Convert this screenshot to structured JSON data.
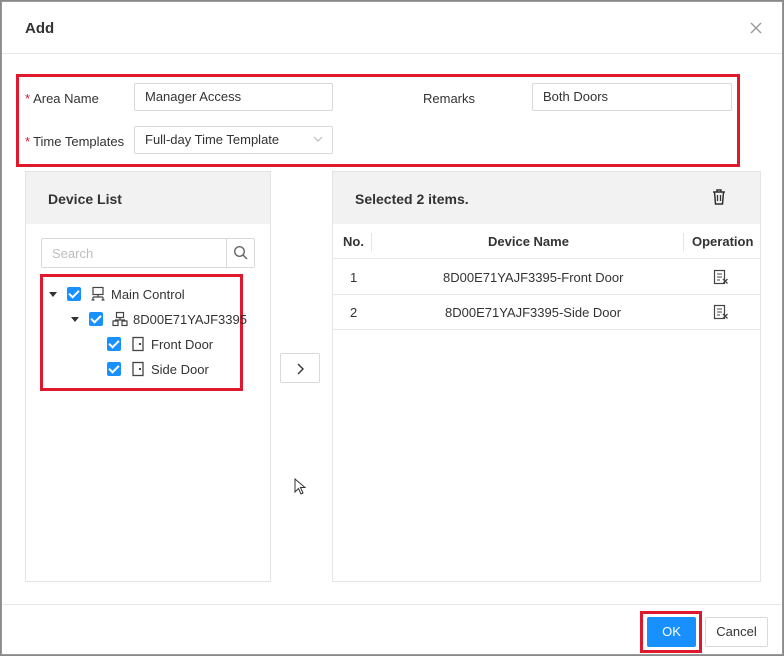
{
  "dialog": {
    "title": "Add"
  },
  "form": {
    "area_name_label": "Area Name",
    "area_name_value": "Manager Access",
    "remarks_label": "Remarks",
    "remarks_value": "Both Doors",
    "time_templates_label": "Time Templates",
    "time_templates_value": "Full-day Time Template",
    "required_mark": "*"
  },
  "device_list": {
    "title": "Device List",
    "search_placeholder": "Search",
    "tree": [
      {
        "label": "Main Control",
        "checked": true,
        "icon": "controller-icon"
      },
      {
        "label": "8D00E71YAJF3395",
        "checked": true,
        "icon": "device-icon"
      },
      {
        "label": "Front Door",
        "checked": true,
        "icon": "door-icon"
      },
      {
        "label": "Side Door",
        "checked": true,
        "icon": "door-icon"
      }
    ]
  },
  "selected": {
    "title": "Selected 2 items.",
    "columns": [
      "No.",
      "Device Name",
      "Operation"
    ],
    "rows": [
      {
        "no": "1",
        "device_name": "8D00E71YAJF3395-Front Door"
      },
      {
        "no": "2",
        "device_name": "8D00E71YAJF3395-Side Door"
      }
    ]
  },
  "footer": {
    "ok_label": "OK",
    "cancel_label": "Cancel"
  },
  "colors": {
    "primary": "#1890ff",
    "highlight": "#e0182d"
  }
}
